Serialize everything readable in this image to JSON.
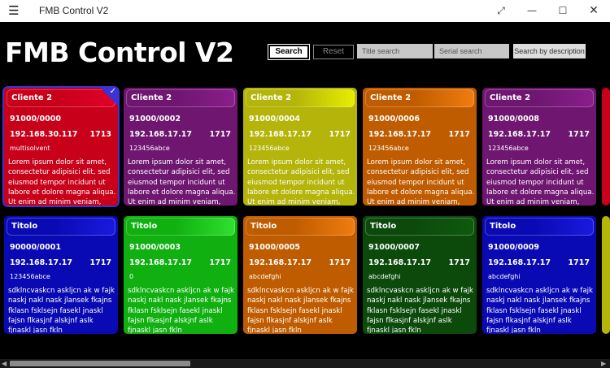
{
  "window": {
    "title": "FMB Control V2",
    "menu_icon": "hamburger-icon",
    "controls": [
      "fullscreen-icon",
      "minimize-icon",
      "maximize-icon",
      "close-icon"
    ]
  },
  "app": {
    "title": "FMB Control V2"
  },
  "toolbar": {
    "search_label": "Search",
    "reset_label": "Reset",
    "title_search_placeholder": "Title search",
    "serial_search_placeholder": "Serial search",
    "description_search_placeholder": "Search by description"
  },
  "cards": [
    {
      "title": "Cliente 2",
      "serial": "91000/0000",
      "ip": "192.168.30.117",
      "port": "1713",
      "sub": "multisolvent",
      "desc": "Lorem ipsum dolor sit amet, consectetur adipisici elit, sed eiusmod tempor incidunt ut labore et dolore magna aliqua. Ut enim ad minim veniam, quis",
      "color": "#c8001a",
      "head_from": "#e0002a",
      "head_to": "#c8001a",
      "selected": true
    },
    {
      "title": "Cliente 2",
      "serial": "91000/0002",
      "ip": "192.168.17.17",
      "port": "1717",
      "sub": "123456abce",
      "desc": "Lorem ipsum dolor sit amet, consectetur adipisici elit, sed eiusmod tempor incidunt ut labore et dolore magna aliqua. Ut enim ad minim veniam, quis",
      "color": "#6e1670",
      "head_from": "#8a1e8c",
      "head_to": "#6e1670",
      "selected": false
    },
    {
      "title": "Cliente 2",
      "serial": "91000/0004",
      "ip": "192.168.17.17",
      "port": "1717",
      "sub": "123456abce",
      "desc": "Lorem ipsum dolor sit amet, consectetur adipisici elit, sed eiusmod tempor incidunt ut labore et dolore magna aliqua. Ut enim ad minim veniam, quis",
      "color": "#b4b40a",
      "head_from": "#e6ee00",
      "head_to": "#b4b40a",
      "selected": false
    },
    {
      "title": "Cliente 2",
      "serial": "91000/0006",
      "ip": "192.168.17.17",
      "port": "1717",
      "sub": "123456abce",
      "desc": "Lorem ipsum dolor sit amet, consectetur adipisici elit, sed eiusmod tempor incidunt ut labore et dolore magna aliqua. Ut enim ad minim veniam, quis",
      "color": "#c05c00",
      "head_from": "#f07c10",
      "head_to": "#c05c00",
      "selected": false
    },
    {
      "title": "Cliente 2",
      "serial": "91000/0008",
      "ip": "192.168.17.17",
      "port": "1717",
      "sub": "123456abce",
      "desc": "Lorem ipsum dolor sit amet, consectetur adipisici elit, sed eiusmod tempor incidunt ut labore et dolore magna aliqua. Ut enim ad minim veniam, quis",
      "color": "#6e1670",
      "head_from": "#8a1e8c",
      "head_to": "#6e1670",
      "selected": false
    },
    {
      "title": "Titolo",
      "serial": "90000/0001",
      "ip": "192.168.17.17",
      "port": "1717",
      "sub": "123456abce",
      "desc": "sdklncvaskcn askljcn ak w fajk naskj nakl nask jlansek fkajns fklasn fsklsejn fasekl jnaskl fajsn flkasjnf alskjnf aslk fjnaskl jasn fkln",
      "color": "#0a0ab4",
      "head_from": "#1a1ae0",
      "head_to": "#0a0ab4",
      "selected": false
    },
    {
      "title": "Titolo",
      "serial": "91000/0003",
      "ip": "192.168.17.17",
      "port": "1717",
      "sub": "0",
      "desc": "sdklncvaskcn askljcn ak w fajk naskj nakl nask jlansek fkajns fklasn fsklsejn fasekl jnaskl fajsn flkasjnf alskjnf aslk fjnaskl jasn fkln",
      "color": "#10b010",
      "head_from": "#30e030",
      "head_to": "#10b010",
      "selected": false
    },
    {
      "title": "Titolo",
      "serial": "91000/0005",
      "ip": "192.168.17.17",
      "port": "1717",
      "sub": "abcdefghi",
      "desc": "sdklncvaskcn askljcn ak w fajk naskj nakl nask jlansek fkajns fklasn fsklsejn fasekl jnaskl fajsn flkasjnf alskjnf aslk fjnaskl jasn fkln",
      "color": "#c05c00",
      "head_from": "#f07c10",
      "head_to": "#c05c00",
      "selected": false
    },
    {
      "title": "Titolo",
      "serial": "91000/0007",
      "ip": "192.168.17.17",
      "port": "1717",
      "sub": "abcdefghi",
      "desc": "sdklncvaskcn askljcn ak w fajk naskj nakl nask jlansek fkajns fklasn fsklsejn fasekl jnaskl fajsn flkasjnf alskjnf aslk fjnaskl jasn fkln",
      "color": "#0c4a0c",
      "head_from": "#0e5a0e",
      "head_to": "#0c4a0c",
      "selected": false
    },
    {
      "title": "Titolo",
      "serial": "91000/0009",
      "ip": "192.168.17.17",
      "port": "1717",
      "sub": "abcdefghi",
      "desc": "sdklncvaskcn askljcn ak w fajk naskj nakl nask jlansek fkajns fklasn fsklsejn fasekl jnaskl fajsn flkasjnf alskjnf aslk fjnaskl jasn fkln",
      "color": "#0a0ab4",
      "head_from": "#1a1ae0",
      "head_to": "#0a0ab4",
      "selected": false
    }
  ],
  "edge_card_colors": [
    "#c8001a",
    "#b4b40a"
  ],
  "scrollbar": {
    "left_icon": "scroll-left-icon",
    "right_icon": "scroll-right-icon"
  }
}
